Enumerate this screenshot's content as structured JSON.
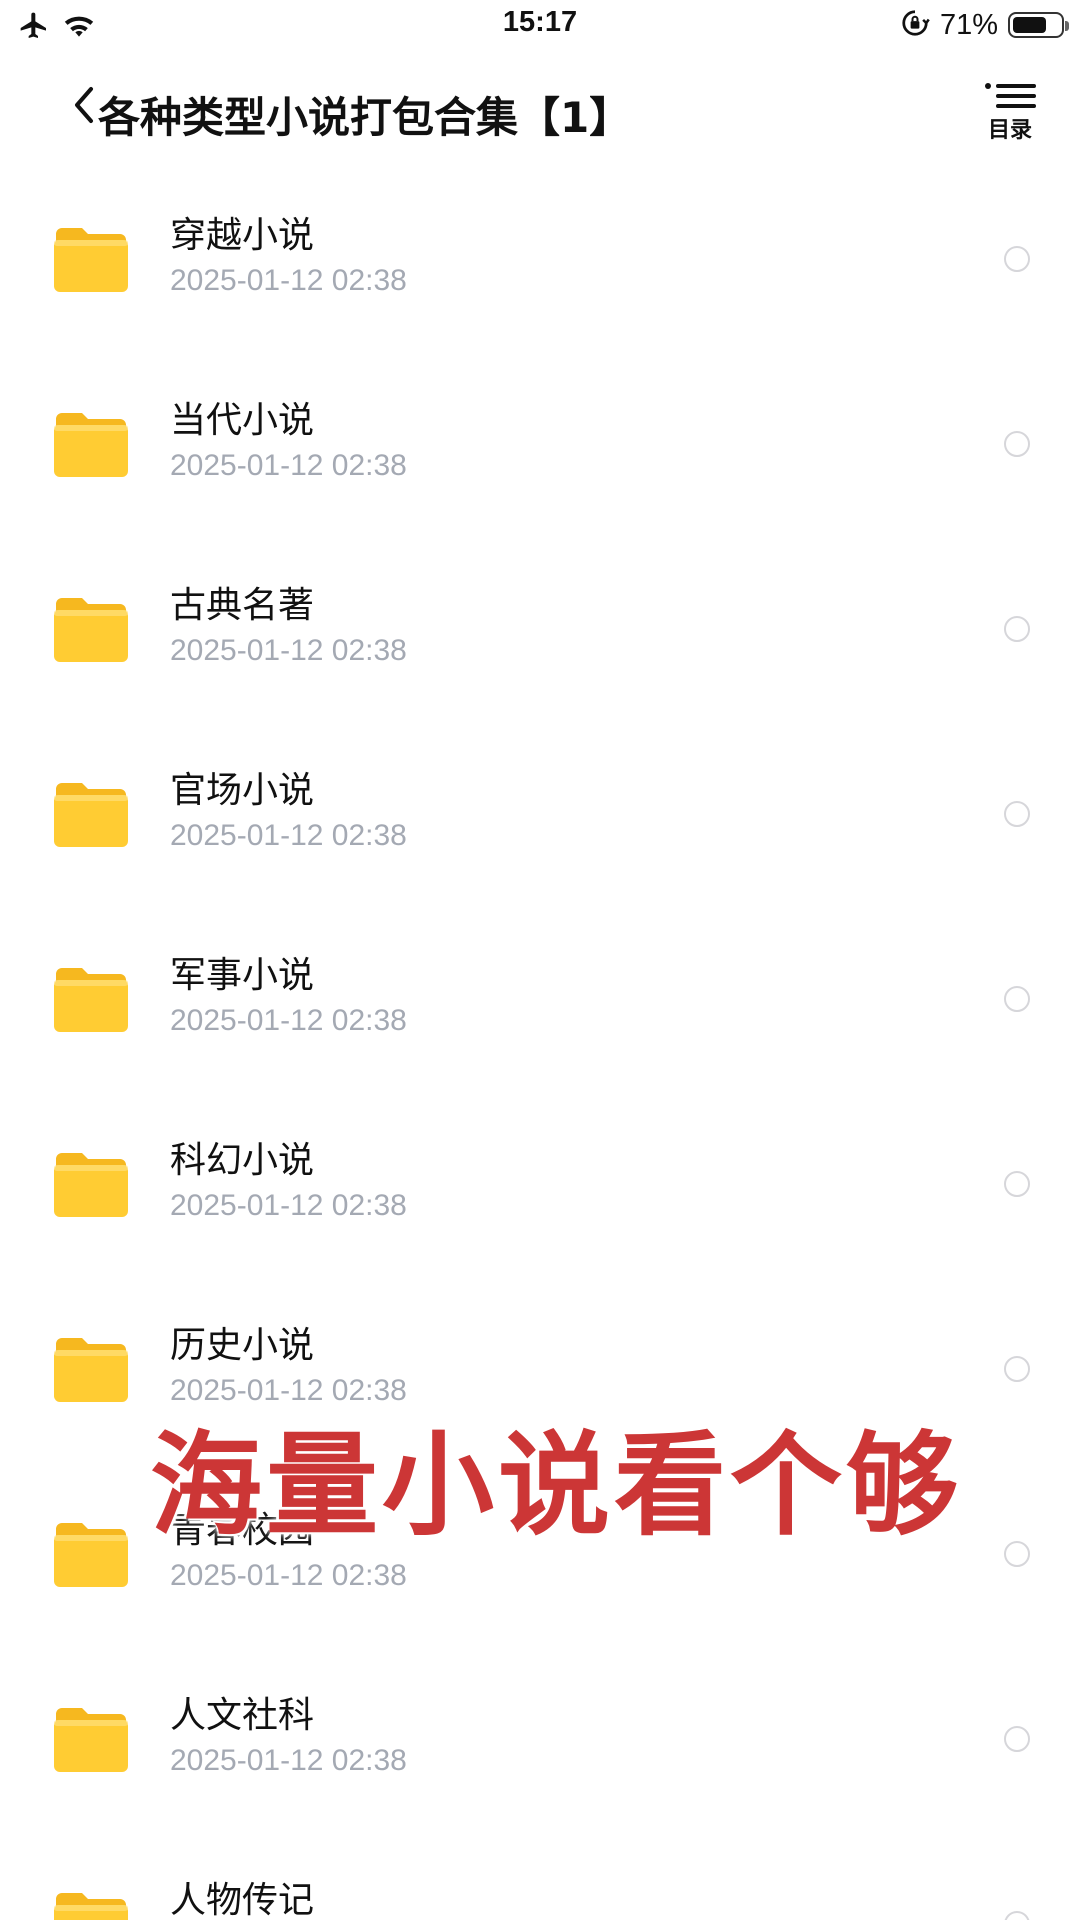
{
  "status_bar": {
    "time": "15:17",
    "battery_percent": "71%",
    "battery_level": 0.71,
    "icons": [
      "airplane-icon",
      "wifi-icon",
      "orientation-lock-icon",
      "battery-icon"
    ]
  },
  "nav": {
    "back_icon": "chevron-left-icon",
    "title": "各种类型小说打包合集【1】",
    "menu_icon": "list-icon",
    "menu_label": "目录"
  },
  "files": [
    {
      "name": "穿越小说",
      "date": "2025-01-12 02:38"
    },
    {
      "name": "当代小说",
      "date": "2025-01-12 02:38"
    },
    {
      "name": "古典名著",
      "date": "2025-01-12 02:38"
    },
    {
      "name": "官场小说",
      "date": "2025-01-12 02:38"
    },
    {
      "name": "军事小说",
      "date": "2025-01-12 02:38"
    },
    {
      "name": "科幻小说",
      "date": "2025-01-12 02:38"
    },
    {
      "name": "历史小说",
      "date": "2025-01-12 02:38"
    },
    {
      "name": "青春校园",
      "date": "2025-01-12 02:38"
    },
    {
      "name": "人文社科",
      "date": "2025-01-12 02:38"
    },
    {
      "name": "人物传记",
      "date": ""
    }
  ],
  "overlay": {
    "promo_text": "海量小说看个够",
    "color": "#cc3636"
  },
  "colors": {
    "folder": "#ffcc33",
    "date_text": "#a4a9b3"
  }
}
